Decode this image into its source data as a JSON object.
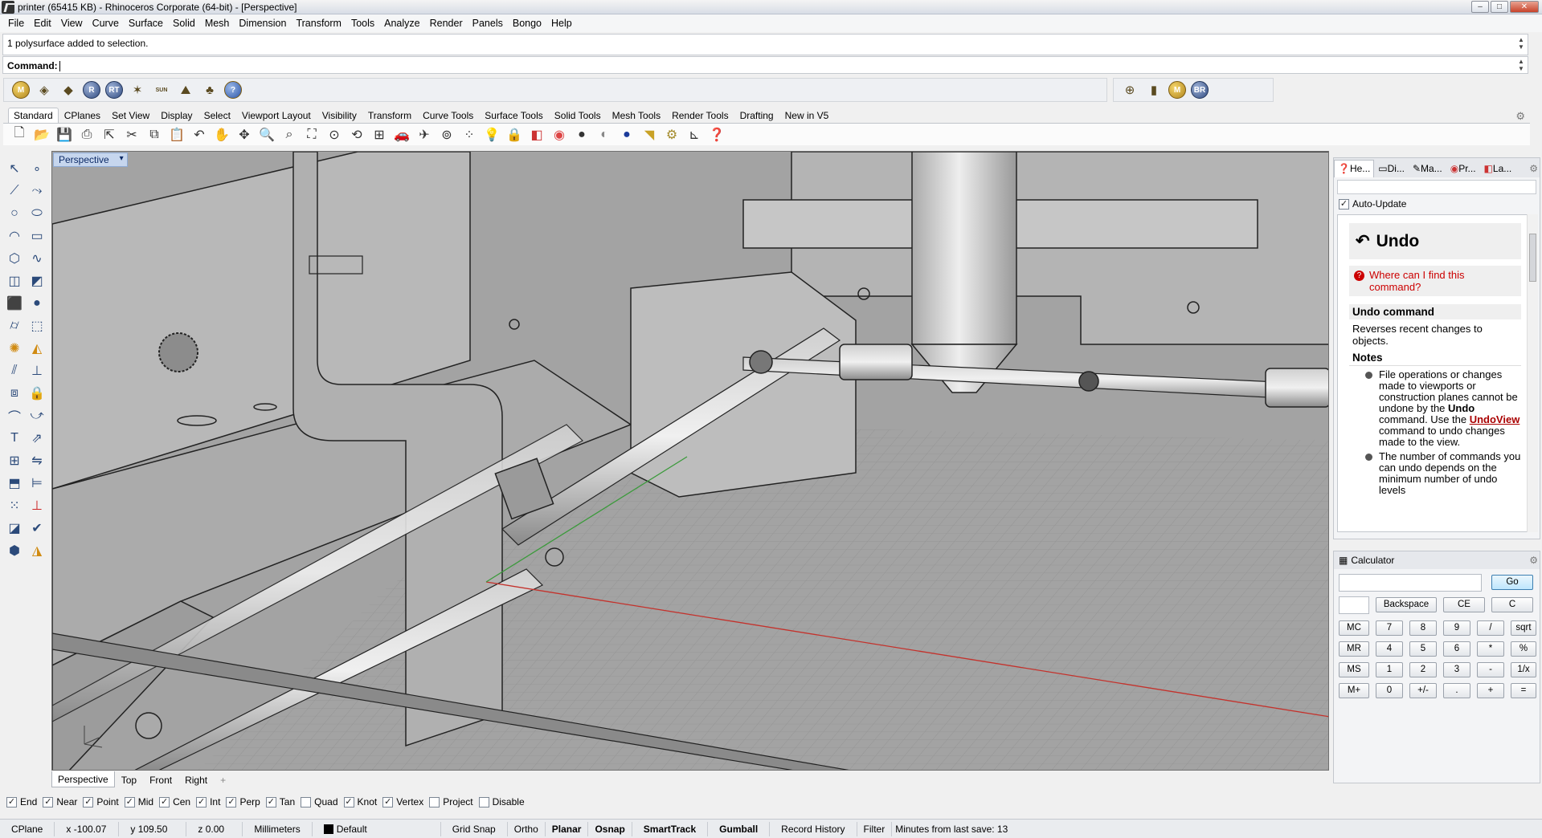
{
  "window": {
    "title": "printer (65415 KB) - Rhinoceros Corporate (64-bit) - [Perspective]",
    "min": "–",
    "max": "□",
    "close": "✕"
  },
  "menu": [
    "File",
    "Edit",
    "View",
    "Curve",
    "Surface",
    "Solid",
    "Mesh",
    "Dimension",
    "Transform",
    "Tools",
    "Analyze",
    "Render",
    "Panels",
    "Bongo",
    "Help"
  ],
  "command": {
    "history": "1 polysurface added to selection.",
    "prompt": "Command:"
  },
  "plugin_toolbar": {
    "left": [
      "M",
      "",
      "",
      "R",
      "RT",
      "",
      "SUN",
      "",
      "",
      ""
    ],
    "right": [
      "",
      "",
      "M",
      "BR"
    ]
  },
  "toolbar_tabs": [
    "Standard",
    "CPlanes",
    "Set View",
    "Display",
    "Select",
    "Viewport Layout",
    "Visibility",
    "Transform",
    "Curve Tools",
    "Surface Tools",
    "Solid Tools",
    "Mesh Tools",
    "Render Tools",
    "Drafting",
    "New in V5"
  ],
  "viewport": {
    "label": "Perspective",
    "tabs": [
      "Perspective",
      "Top",
      "Front",
      "Right"
    ],
    "add": "+"
  },
  "osnaps": [
    {
      "label": "End",
      "checked": true
    },
    {
      "label": "Near",
      "checked": true
    },
    {
      "label": "Point",
      "checked": true
    },
    {
      "label": "Mid",
      "checked": true
    },
    {
      "label": "Cen",
      "checked": true
    },
    {
      "label": "Int",
      "checked": true
    },
    {
      "label": "Perp",
      "checked": true
    },
    {
      "label": "Tan",
      "checked": true
    },
    {
      "label": "Quad",
      "checked": false
    },
    {
      "label": "Knot",
      "checked": true
    },
    {
      "label": "Vertex",
      "checked": true
    },
    {
      "label": "Project",
      "checked": false
    },
    {
      "label": "Disable",
      "checked": false
    }
  ],
  "status": {
    "cplane": "CPlane",
    "x": "x -100.07",
    "y": "y 109.50",
    "z": "z 0.00",
    "units": "Millimeters",
    "layer": "Default",
    "grid_snap": "Grid Snap",
    "ortho": "Ortho",
    "planar": "Planar",
    "osnap": "Osnap",
    "smarttrack": "SmartTrack",
    "gumball": "Gumball",
    "record_history": "Record History",
    "filter": "Filter",
    "save": "Minutes from last save: 13"
  },
  "help_panel": {
    "tabs": [
      "He...",
      "Di...",
      "Ma...",
      "Pr...",
      "La..."
    ],
    "auto_update": "Auto-Update",
    "title": "Undo",
    "where": "Where can I find this command?",
    "section": "Undo command",
    "description": "Reverses recent changes to objects.",
    "notes_title": "Notes",
    "note1_a": "File operations or changes made to viewports or construction planes cannot be undone by the ",
    "note1_b": "Undo",
    "note1_c": " command. Use the ",
    "note1_link": "UndoView",
    "note1_d": " command to undo changes made to the view.",
    "note2": "The number of commands you can undo depends on the minimum number of undo levels"
  },
  "calculator": {
    "title": "Calculator",
    "go": "Go",
    "backspace": "Backspace",
    "ce": "CE",
    "c": "C",
    "rows": [
      [
        "MC",
        "7",
        "8",
        "9",
        "/",
        "sqrt"
      ],
      [
        "MR",
        "4",
        "5",
        "6",
        "*",
        "%"
      ],
      [
        "MS",
        "1",
        "2",
        "3",
        "-",
        "1/x"
      ],
      [
        "M+",
        "0",
        "+/-",
        ".",
        "+",
        "="
      ]
    ]
  }
}
